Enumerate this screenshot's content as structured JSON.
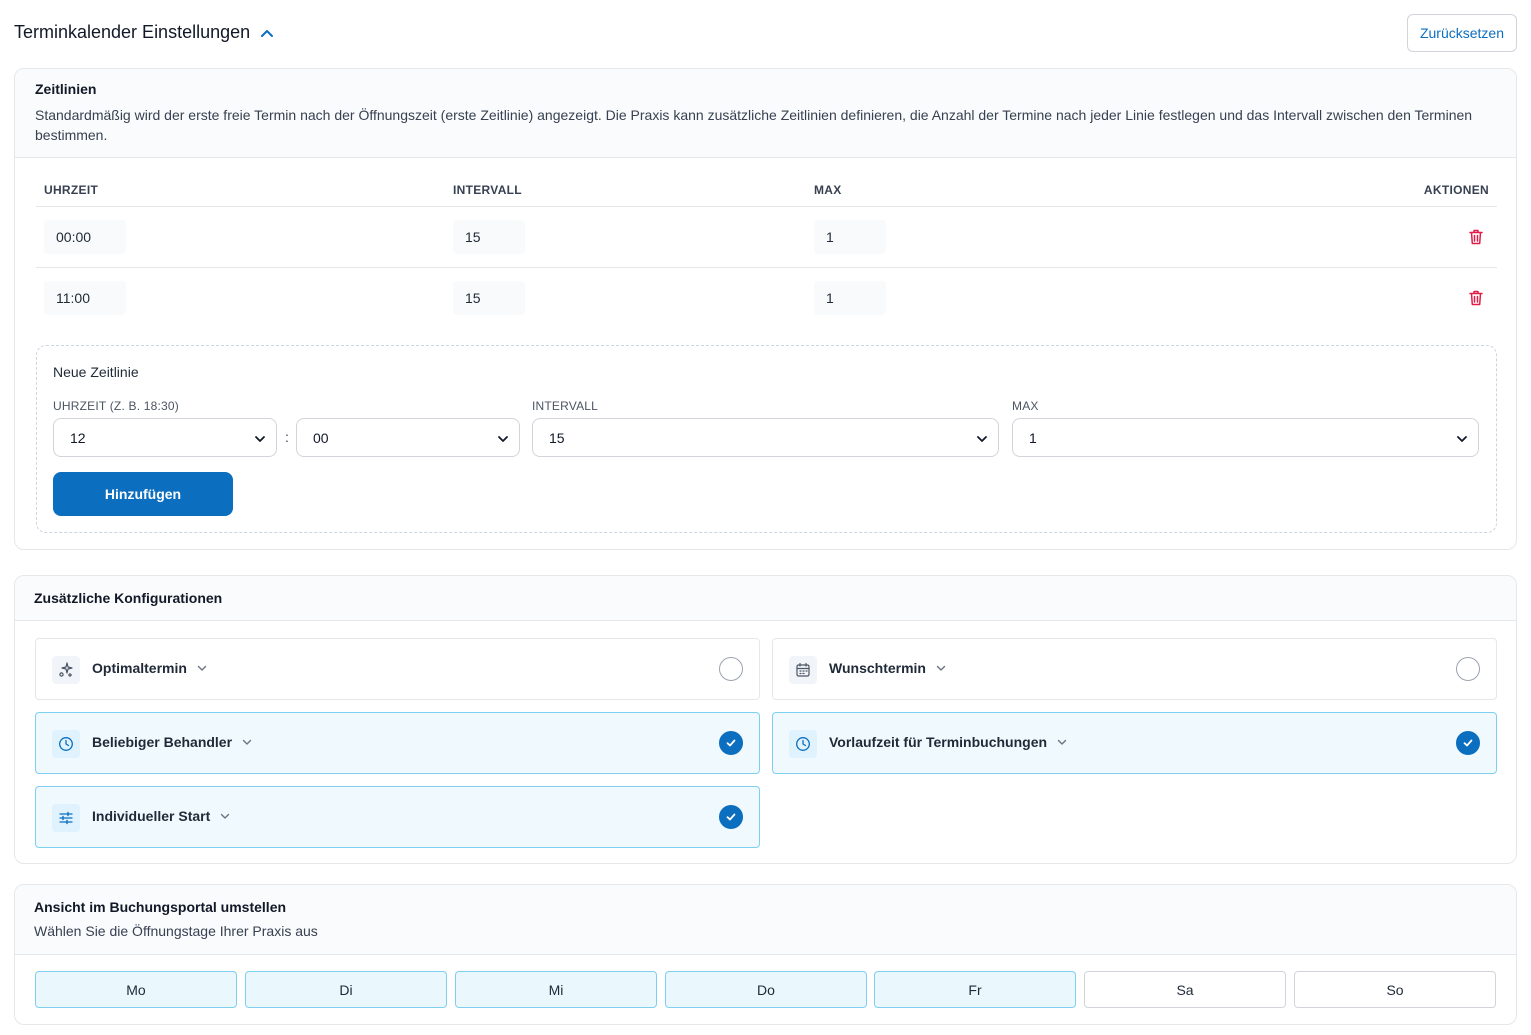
{
  "header": {
    "title": "Terminkalender Einstellungen",
    "reset_label": "Zurücksetzen"
  },
  "zeitlinien": {
    "title": "Zeitlinien",
    "description": "Standardmäßig wird der erste freie Termin nach der Öffnungszeit (erste Zeitlinie) angezeigt. Die Praxis kann zusätzliche Zeitlinien definieren, die Anzahl der Termine nach jeder Linie festlegen und das Intervall zwischen den Terminen bestimmen.",
    "columns": {
      "uhrzeit": "UHRZEIT",
      "intervall": "INTERVALL",
      "max": "MAX",
      "aktionen": "AKTIONEN"
    },
    "rows": [
      {
        "uhrzeit": "00:00",
        "intervall": "15",
        "max": "1"
      },
      {
        "uhrzeit": "11:00",
        "intervall": "15",
        "max": "1"
      }
    ]
  },
  "new_line": {
    "title": "Neue Zeitlinie",
    "uhrzeit_label": "UHRZEIT (Z. B. 18:30)",
    "intervall_label": "INTERVALL",
    "max_label": "MAX",
    "hour_value": "12",
    "colon": ":",
    "minute_value": "00",
    "intervall_value": "15",
    "max_value": "1",
    "add_label": "Hinzufügen"
  },
  "konfigurationen": {
    "title": "Zusätzliche Konfigurationen",
    "options": [
      {
        "label": "Optimaltermin",
        "icon": "sparkles-icon",
        "checked": false
      },
      {
        "label": "Wunschtermin",
        "icon": "calendar-icon",
        "checked": false
      },
      {
        "label": "Beliebiger Behandler",
        "icon": "clock-icon",
        "checked": true
      },
      {
        "label": "Vorlaufzeit für Terminbuchungen",
        "icon": "clock-icon",
        "checked": true
      },
      {
        "label": "Individueller Start",
        "icon": "sliders-icon",
        "checked": true
      }
    ]
  },
  "ansicht": {
    "title": "Ansicht im Buchungsportal umstellen",
    "description": "Wählen Sie die Öffnungstage Ihrer Praxis aus",
    "days": [
      {
        "label": "Mo",
        "selected": true
      },
      {
        "label": "Di",
        "selected": true
      },
      {
        "label": "Mi",
        "selected": true
      },
      {
        "label": "Do",
        "selected": true
      },
      {
        "label": "Fr",
        "selected": true
      },
      {
        "label": "Sa",
        "selected": false
      },
      {
        "label": "So",
        "selected": false
      }
    ]
  },
  "colors": {
    "primary": "#0b6ebf",
    "selected_bg": "#f0fafe",
    "selected_border": "#7fd0f0",
    "danger": "#e11d48"
  }
}
